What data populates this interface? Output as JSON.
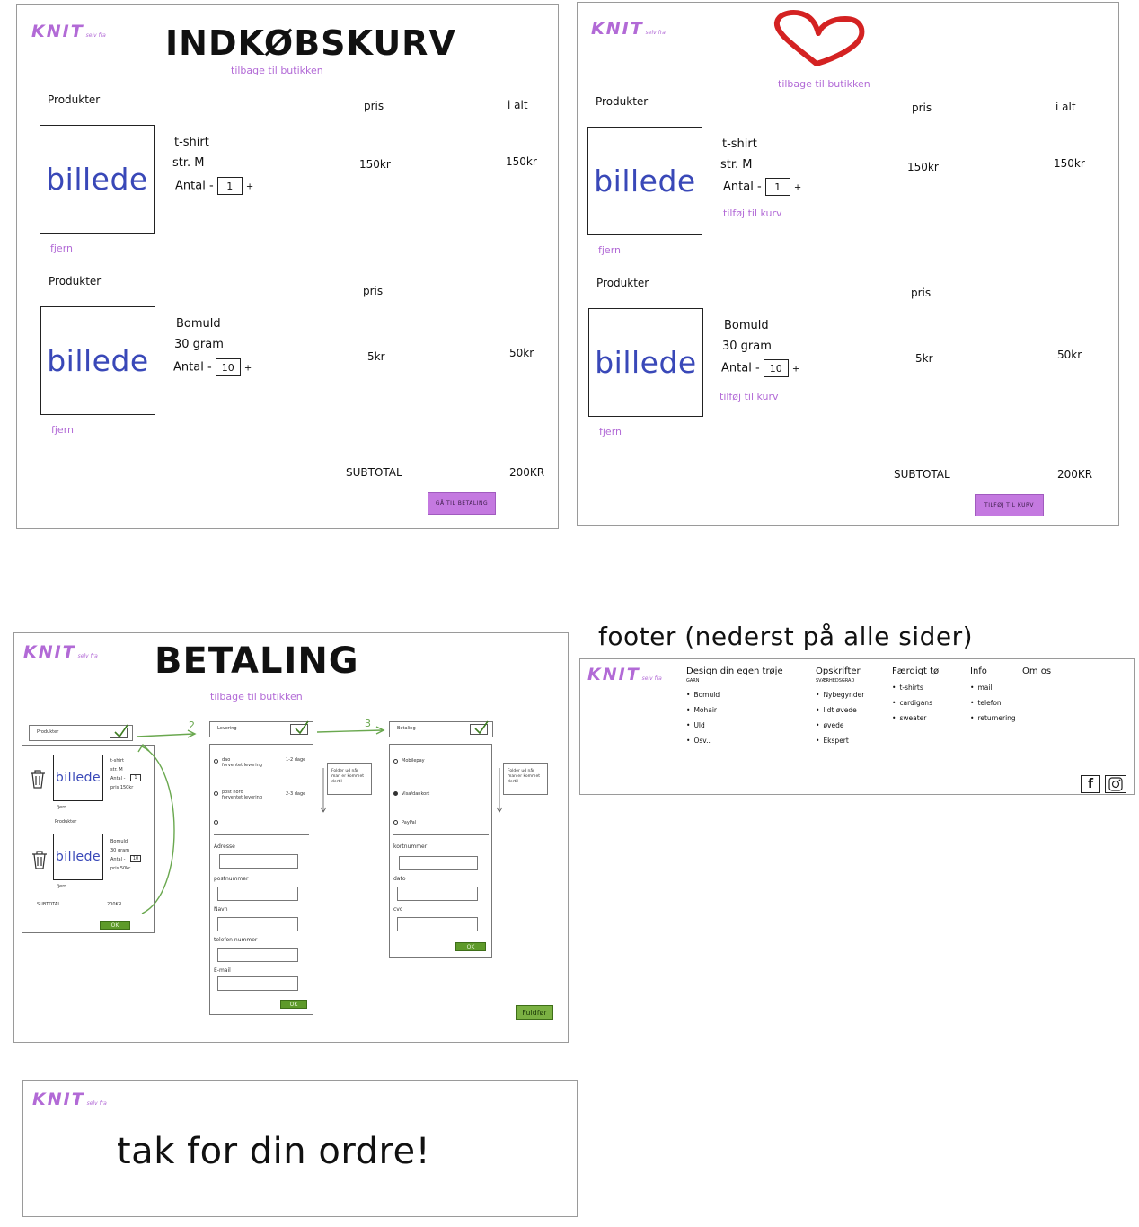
{
  "logo": {
    "text": "KNIT",
    "sub": "selv fra"
  },
  "panel1": {
    "title": "INDKØBSKURV",
    "back_link": "tilbage til butikken",
    "items": [
      {
        "section_label": "Produkter",
        "col_price": "pris",
        "col_total": "i alt",
        "image": "billede",
        "name": "t-shirt",
        "detail": "str. M",
        "qty_label": "Antal -",
        "qty": "1",
        "plus": "+",
        "price": "150kr",
        "total": "150kr",
        "remove": "fjern"
      },
      {
        "section_label": "Produkter",
        "col_price": "pris",
        "image": "billede",
        "name": "Bomuld",
        "detail": "30 gram",
        "qty_label": "Antal -",
        "qty": "10",
        "plus": "+",
        "price": "5kr",
        "total": "50kr",
        "remove": "fjern"
      }
    ],
    "subtotal_label": "SUBTOTAL",
    "subtotal_value": "200KR",
    "button": "GÅ TIL BETALING"
  },
  "panel2": {
    "back_link": "tilbage til butikken",
    "items": [
      {
        "section_label": "Produkter",
        "col_price": "pris",
        "col_total": "i alt",
        "image": "billede",
        "name": "t-shirt",
        "detail": "str. M",
        "qty_label": "Antal -",
        "qty": "1",
        "plus": "+",
        "add": "tilføj til kurv",
        "price": "150kr",
        "total": "150kr",
        "remove": "fjern"
      },
      {
        "section_label": "Produkter",
        "col_price": "pris",
        "image": "billede",
        "name": "Bomuld",
        "detail": "30 gram",
        "qty_label": "Antal -",
        "qty": "10",
        "plus": "+",
        "add": "tilføj til kurv",
        "price": "5kr",
        "total": "50kr",
        "remove": "fjern"
      }
    ],
    "subtotal_label": "SUBTOTAL",
    "subtotal_value": "200KR",
    "button": "TILFØJ TIL KURV"
  },
  "panel3": {
    "title": "BETALING",
    "back_link": "tilbage til butikken",
    "step1": {
      "header": "Produkter",
      "items": [
        {
          "image": "billede",
          "lines": [
            "t-shirt",
            "str. M",
            "Antal -",
            "pris 150kr"
          ],
          "qty": "1",
          "remove": "fjern"
        },
        {
          "image": "billede",
          "lines": [
            "Bomuld",
            "30 gram",
            "Antal -",
            "pris 50kr"
          ],
          "qty": "10",
          "remove": "fjern"
        }
      ],
      "products_label": "Produkter",
      "subtotal_label": "SUBTOTAL",
      "subtotal_value": "200KR",
      "ok": "OK"
    },
    "arrow2": "2",
    "arrow3": "3",
    "step2": {
      "header": "Levering",
      "options": [
        {
          "label": "dao\nforventet levering",
          "days": "1-2 dage"
        },
        {
          "label": "post nord\nforventet levering",
          "days": "2-3 dage"
        },
        {
          "label": "",
          "days": ""
        }
      ],
      "note": "Folder ud når man er kommet dertil",
      "fields": [
        "Adresse",
        "postnummer",
        "Navn",
        "telefon nummer",
        "E-mail"
      ],
      "ok": "OK"
    },
    "step3": {
      "header": "Betaling",
      "options": [
        "Mobilepay",
        "Visa/dankort",
        "PayPal"
      ],
      "note": "Folder ud når man er kommet dertil",
      "fields": [
        "kortnummer",
        "dato",
        "cvc"
      ],
      "ok": "OK"
    },
    "finish_button": "Fuldfør"
  },
  "footer_heading": "footer (nederst på alle sider)",
  "footer": {
    "columns": [
      {
        "title": "Design din egen trøje",
        "sub": "GARN",
        "items": [
          "Bomuld",
          "Mohair",
          "Uld",
          "Osv.."
        ]
      },
      {
        "title": "Opskrifter",
        "sub": "SVÆRHEDSGRAD",
        "items": [
          "Nybegynder",
          "lidt øvede",
          "øvede",
          "Ekspert"
        ]
      },
      {
        "title": "Færdigt tøj",
        "sub": "",
        "items": [
          "t-shirts",
          "cardigans",
          "sweater"
        ]
      },
      {
        "title": "Info",
        "sub": "",
        "items": [
          "mail",
          "telefon",
          "returnering"
        ]
      },
      {
        "title": "Om os",
        "sub": "",
        "items": []
      }
    ],
    "social": [
      "facebook-icon",
      "instagram-icon"
    ]
  },
  "panel5": {
    "message": "tak for din ordre!"
  },
  "colors": {
    "accent": "#b26ad6",
    "button_purple": "#c479e0",
    "button_green": "#5e9a2a",
    "image_text": "#3948b8",
    "heart": "#d42222"
  }
}
